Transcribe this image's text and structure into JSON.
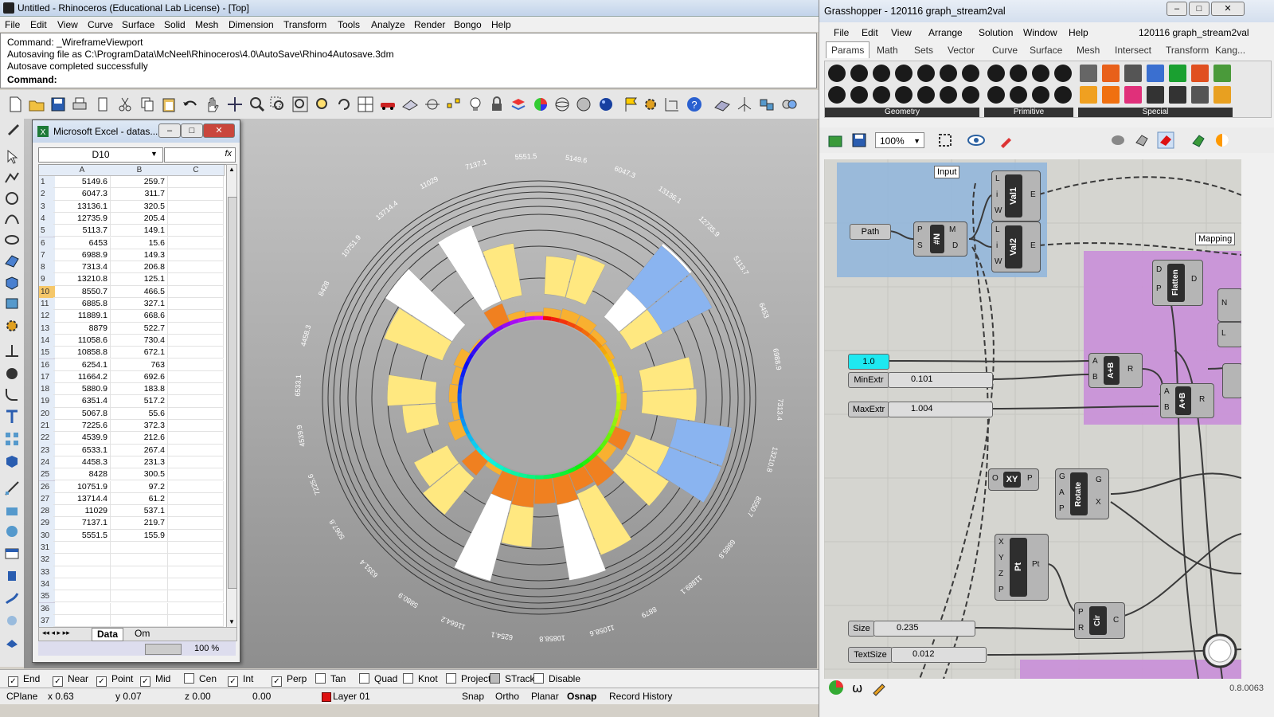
{
  "rhino": {
    "title": "Untitled - Rhinoceros (Educational Lab License) - [Top]",
    "menu": [
      "File",
      "Edit",
      "View",
      "Curve",
      "Surface",
      "Solid",
      "Mesh",
      "Dimension",
      "Transform",
      "Tools",
      "Analyze",
      "Render",
      "Bongo",
      "Help"
    ],
    "command_history": [
      "Command: _WireframeViewport",
      "Autosaving file as C:\\ProgramData\\McNeel\\Rhinoceros\\4.0\\AutoSave\\Rhino4Autosave.3dm",
      "Autosave completed successfully"
    ],
    "command_prompt": "Command:",
    "osnap": [
      {
        "label": "End",
        "checked": true
      },
      {
        "label": "Near",
        "checked": true
      },
      {
        "label": "Point",
        "checked": true
      },
      {
        "label": "Mid",
        "checked": true
      },
      {
        "label": "Cen",
        "checked": false
      },
      {
        "label": "Int",
        "checked": true
      },
      {
        "label": "Perp",
        "checked": true
      },
      {
        "label": "Tan",
        "checked": false
      },
      {
        "label": "Quad",
        "checked": false
      },
      {
        "label": "Knot",
        "checked": false
      },
      {
        "label": "Project",
        "checked": false
      },
      {
        "label": "STrack",
        "checked": false
      },
      {
        "label": "Disable",
        "checked": false
      }
    ],
    "status": {
      "cplane": "CPlane",
      "x": "x 0.63",
      "y": "y 0.07",
      "z": "z 0.00",
      "d": "0.00",
      "layer": "Layer 01",
      "layer_color": "#dd1111",
      "snap": "Snap",
      "ortho": "Ortho",
      "planar": "Planar",
      "osnap": "Osnap",
      "record": "Record History"
    }
  },
  "excel": {
    "title": "Microsoft Excel - datas...",
    "name_box": "D10",
    "fx": "fx",
    "columns": [
      "A",
      "B",
      "C"
    ],
    "rows": [
      [
        "5149.6",
        "259.7"
      ],
      [
        "6047.3",
        "311.7"
      ],
      [
        "13136.1",
        "320.5"
      ],
      [
        "12735.9",
        "205.4"
      ],
      [
        "5113.7",
        "149.1"
      ],
      [
        "6453",
        "15.6"
      ],
      [
        "6988.9",
        "149.3"
      ],
      [
        "7313.4",
        "206.8"
      ],
      [
        "13210.8",
        "125.1"
      ],
      [
        "8550.7",
        "466.5"
      ],
      [
        "6885.8",
        "327.1"
      ],
      [
        "11889.1",
        "668.6"
      ],
      [
        "8879",
        "522.7"
      ],
      [
        "11058.6",
        "730.4"
      ],
      [
        "10858.8",
        "672.1"
      ],
      [
        "6254.1",
        "763"
      ],
      [
        "11664.2",
        "692.6"
      ],
      [
        "5880.9",
        "183.8"
      ],
      [
        "6351.4",
        "517.2"
      ],
      [
        "5067.8",
        "55.6"
      ],
      [
        "7225.6",
        "372.3"
      ],
      [
        "4539.9",
        "212.6"
      ],
      [
        "6533.1",
        "267.4"
      ],
      [
        "4458.3",
        "231.3"
      ],
      [
        "8428",
        "300.5"
      ],
      [
        "10751.9",
        "97.2"
      ],
      [
        "13714.4",
        "61.2"
      ],
      [
        "11029",
        "537.1"
      ],
      [
        "7137.1",
        "219.7"
      ],
      [
        "5551.5",
        "155.9"
      ]
    ],
    "empty_row_numbers": [
      "31",
      "32",
      "33",
      "34",
      "35",
      "36",
      "37"
    ],
    "selected_row": "10",
    "sheet_tabs": [
      "Data",
      "Om"
    ],
    "zoom": "100 %"
  },
  "viewport_labels": [
    "5149.6",
    "6047.3",
    "13136.1",
    "12735.9",
    "5113.7",
    "6453",
    "6988.9",
    "7313.4",
    "13210.8",
    "8550.7",
    "6885.8",
    "11889.1",
    "8879",
    "11058.6",
    "10858.8",
    "6254.1",
    "11664.2",
    "5880.9",
    "6351.4",
    "5067.8",
    "7225.6",
    "4539.9",
    "6533.1",
    "4458.3",
    "8428",
    "10751.9",
    "13714.4",
    "11029",
    "7137.1",
    "5551.5"
  ],
  "grasshopper": {
    "title": "Grasshopper - 120116 graph_stream2val",
    "menu": [
      "File",
      "Edit",
      "View",
      "Arrange",
      "Solution",
      "Window",
      "Help"
    ],
    "doc_name": "120116 graph_stream2val",
    "tabs": [
      "Params",
      "Math",
      "Sets",
      "Vector",
      "Curve",
      "Surface",
      "Mesh",
      "Intersect",
      "Transform",
      "Kang..."
    ],
    "active_tab": "Params",
    "groups": [
      "Geometry",
      "Primitive",
      "Special"
    ],
    "zoom": "100%",
    "version": "0.8.0063",
    "nodes": {
      "input_group": "Input",
      "mapping_group": "Mapping",
      "path": "Path",
      "val1": "Val1",
      "val2": "Val2",
      "flatten": "Flatten",
      "one": "1.0",
      "min_extr_label": "MinExtr",
      "min_extr_value": "0.101",
      "max_extr_label": "MaxExtr",
      "max_extr_value": "1.004",
      "xy": "XY",
      "rotate": "Rotate",
      "pt": "Pt",
      "cir": "Cir",
      "size_label": "Size",
      "size_value": "0.235",
      "textsize_label": "TextSize",
      "textsize_value": "0.012",
      "addition": "A+B"
    }
  }
}
